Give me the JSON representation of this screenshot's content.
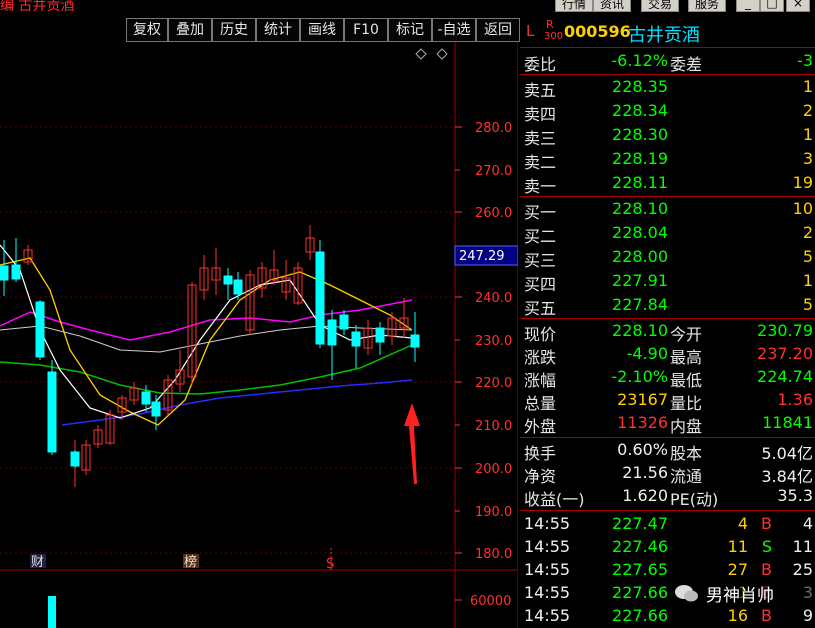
{
  "window": {
    "title_left": "编 古井贡酒",
    "top_buttons": [
      "行情",
      "资讯",
      "交易",
      "服务"
    ]
  },
  "toolbar": {
    "buttons": [
      "复权",
      "叠加",
      "历史",
      "统计",
      "画线",
      "F10",
      "标记",
      "-自选",
      "返回"
    ]
  },
  "chart": {
    "price_axis": [
      "280.0",
      "270.0",
      "260.0",
      "250.0",
      "240.0",
      "230.0",
      "220.0",
      "210.0",
      "200.0",
      "190.0",
      "180.0"
    ],
    "current_price_tag": "247.29",
    "volume_axis_label": "60000",
    "markers": {
      "cai": "财",
      "bang": "榜",
      "s": "S"
    }
  },
  "quote": {
    "header": {
      "l": "L",
      "r": "R",
      "r_sub": "300",
      "code": "000596",
      "name": "古井贡酒"
    },
    "weibi": {
      "label": "委比",
      "value": "-6.12%",
      "label2": "委差",
      "value2": "-3"
    },
    "sell": [
      {
        "label": "卖五",
        "price": "228.35",
        "vol": "1"
      },
      {
        "label": "卖四",
        "price": "228.34",
        "vol": "2"
      },
      {
        "label": "卖三",
        "price": "228.30",
        "vol": "1"
      },
      {
        "label": "卖二",
        "price": "228.19",
        "vol": "3"
      },
      {
        "label": "卖一",
        "price": "228.11",
        "vol": "19"
      }
    ],
    "buy": [
      {
        "label": "买一",
        "price": "228.10",
        "vol": "10"
      },
      {
        "label": "买二",
        "price": "228.04",
        "vol": "2"
      },
      {
        "label": "买三",
        "price": "228.00",
        "vol": "5"
      },
      {
        "label": "买四",
        "price": "227.91",
        "vol": "1"
      },
      {
        "label": "买五",
        "price": "227.84",
        "vol": "5"
      }
    ],
    "stats": [
      {
        "l1": "现价",
        "v1": "228.10",
        "c1": "green",
        "l2": "今开",
        "v2": "230.79",
        "c2": "green"
      },
      {
        "l1": "涨跌",
        "v1": "-4.90",
        "c1": "green",
        "l2": "最高",
        "v2": "237.20",
        "c2": "red"
      },
      {
        "l1": "涨幅",
        "v1": "-2.10%",
        "c1": "green",
        "l2": "最低",
        "v2": "224.74",
        "c2": "green"
      },
      {
        "l1": "总量",
        "v1": "23167",
        "c1": "yellow",
        "l2": "量比",
        "v2": "1.36",
        "c2": "red"
      },
      {
        "l1": "外盘",
        "v1": "11326",
        "c1": "red",
        "l2": "内盘",
        "v2": "11841",
        "c2": "green"
      }
    ],
    "stats2": [
      {
        "l1": "换手",
        "v1": "0.60%",
        "l2": "股本",
        "v2": "5.04亿"
      },
      {
        "l1": "净资",
        "v1": "21.56",
        "l2": "流通",
        "v2": "3.84亿"
      },
      {
        "l1": "收益(一)",
        "v1": "1.620",
        "l2": "PE(动)",
        "v2": "35.3"
      }
    ],
    "ticks": [
      {
        "time": "14:55",
        "price": "227.47",
        "vol": "4",
        "bs": "B",
        "num": "4",
        "pc": "green",
        "bsc": "red"
      },
      {
        "time": "14:55",
        "price": "227.46",
        "vol": "11",
        "bs": "S",
        "num": "11",
        "pc": "green",
        "bsc": "green"
      },
      {
        "time": "14:55",
        "price": "227.65",
        "vol": "27",
        "bs": "B",
        "num": "25",
        "pc": "green",
        "bsc": "red"
      },
      {
        "time": "14:55",
        "price": "227.66",
        "vol": "1",
        "bs": "B",
        "num": "3",
        "pc": "green",
        "bsc": "red"
      },
      {
        "time": "14:55",
        "price": "227.66",
        "vol": "16",
        "bs": "B",
        "num": "9",
        "pc": "green",
        "bsc": "red"
      }
    ]
  },
  "watermark": {
    "text": "男神肖帅"
  },
  "colors": {
    "up": "#ff3030",
    "down": "#00ffff",
    "axis": "#ff3030",
    "ma5": "#ffffff",
    "ma10": "#ffff00",
    "ma20": "#ff00ff",
    "ma30": "#00c000",
    "ma60": "#2a2aff"
  }
}
